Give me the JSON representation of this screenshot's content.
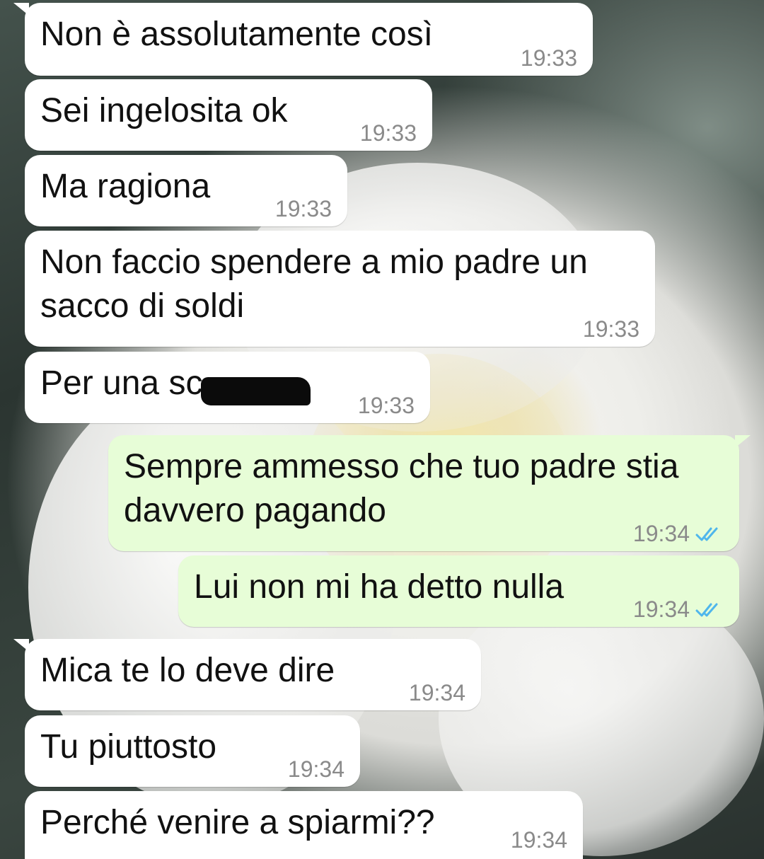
{
  "colors": {
    "incoming_bubble": "#ffffff",
    "outgoing_bubble": "#e7fdd7",
    "timestamp": "#8a8a8a",
    "read_ticks": "#4fb6ec"
  },
  "messages": [
    {
      "direction": "in",
      "text": "Non è assolutamente così",
      "time": "19:33"
    },
    {
      "direction": "in",
      "text": "Sei ingelosita ok",
      "time": "19:33"
    },
    {
      "direction": "in",
      "text": "Ma ragiona",
      "time": "19:33"
    },
    {
      "direction": "in",
      "text": "Non faccio spendere a mio padre un sacco di soldi",
      "time": "19:33"
    },
    {
      "direction": "in",
      "text": "Per una sc",
      "time": "19:33",
      "redacted_suffix": true
    },
    {
      "direction": "out",
      "text": "Sempre ammesso che tuo padre stia davvero pagando",
      "time": "19:34",
      "status_icon": "double-check-read-icon"
    },
    {
      "direction": "out",
      "text": "Lui non mi ha detto nulla",
      "time": "19:34",
      "status_icon": "double-check-read-icon"
    },
    {
      "direction": "in",
      "text": "Mica te lo deve dire",
      "time": "19:34"
    },
    {
      "direction": "in",
      "text": "Tu piuttosto",
      "time": "19:34"
    },
    {
      "direction": "in",
      "text": "Perché venire a spiarmi??",
      "time": "19:34"
    }
  ]
}
